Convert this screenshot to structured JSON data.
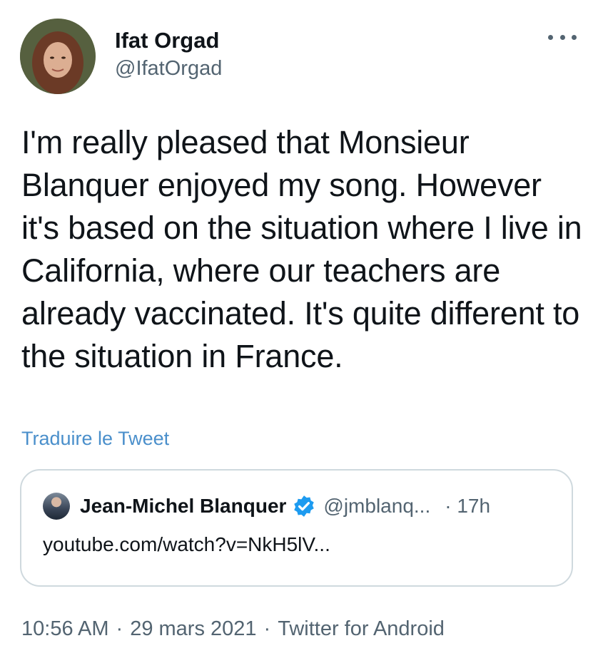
{
  "author": {
    "display_name": "Ifat Orgad",
    "handle": "@IfatOrgad",
    "avatar_icon": "profile-photo"
  },
  "tweet": {
    "text": "I'm really pleased that Monsieur Blanquer enjoyed my song. However it's based on the situation where I live in California, where our teachers are already vaccinated. It's quite different to the situation in France.",
    "translate_label": "Traduire le Tweet"
  },
  "quoted_tweet": {
    "display_name": "Jean-Michel Blanquer",
    "verified": true,
    "handle": "@jmblanq...",
    "time": "· 17h",
    "link_text": "youtube.com/watch?v=NkH5lV..."
  },
  "meta": {
    "time": "10:56 AM",
    "separator": "·",
    "date": "29 mars 2021",
    "source": "Twitter for Android"
  },
  "colors": {
    "link": "#4a8fcb",
    "verified_badge": "#1d9bf0",
    "secondary_text": "#536471",
    "border": "#cfd9de"
  },
  "icons": {
    "more": "more-horizontal-icon",
    "verified": "verified-badge-icon"
  }
}
